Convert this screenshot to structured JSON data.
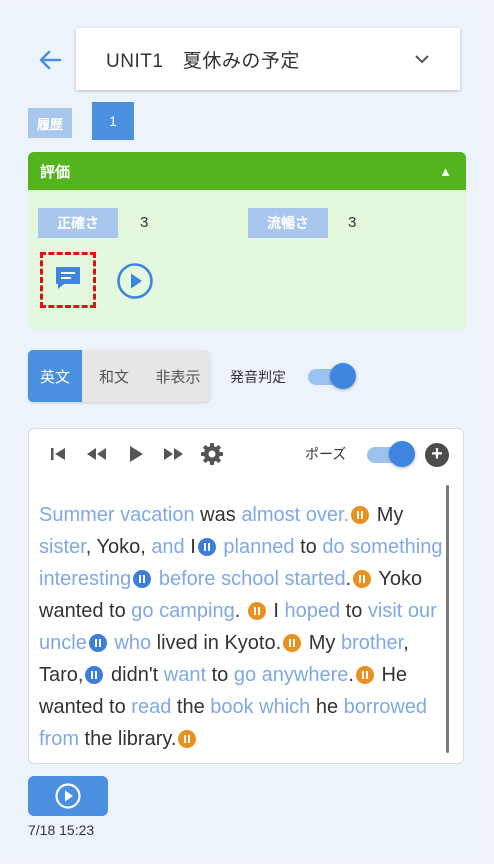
{
  "header": {
    "unit_title": "UNIT1　夏休みの予定"
  },
  "history": {
    "label": "履歴",
    "number": "1"
  },
  "evaluation": {
    "title": "評価",
    "accuracy_label": "正確さ",
    "accuracy_value": "3",
    "fluency_label": "流暢さ",
    "fluency_value": "3"
  },
  "display_tabs": [
    {
      "label": "英文",
      "active": true
    },
    {
      "label": "和文",
      "active": false
    },
    {
      "label": "非表示",
      "active": false
    }
  ],
  "pronunciation": {
    "label": "発音判定",
    "enabled": true
  },
  "player": {
    "pause_label": "ポーズ",
    "pause_enabled": true
  },
  "passage": [
    {
      "t": "Summer vacation",
      "hl": true
    },
    {
      "t": " was "
    },
    {
      "t": "almost over.",
      "hl": true
    },
    {
      "pm": "o"
    },
    {
      "t": " My "
    },
    {
      "t": "sister",
      "hl": true
    },
    {
      "t": ", Yoko, "
    },
    {
      "t": "and",
      "hl": true
    },
    {
      "t": " I"
    },
    {
      "pm": "b"
    },
    {
      "t": " "
    },
    {
      "t": "planned",
      "hl": true
    },
    {
      "t": " to "
    },
    {
      "t": "do something interesting",
      "hl": true
    },
    {
      "pm": "b"
    },
    {
      "t": " "
    },
    {
      "t": "before school started",
      "hl": true
    },
    {
      "t": "."
    },
    {
      "pm": "o"
    },
    {
      "t": " Yoko wanted to "
    },
    {
      "t": "go camping",
      "hl": true
    },
    {
      "t": ". "
    },
    {
      "pm": "o"
    },
    {
      "t": " I "
    },
    {
      "t": "hoped",
      "hl": true
    },
    {
      "t": " to "
    },
    {
      "t": "visit our uncle",
      "hl": true
    },
    {
      "pm": "b"
    },
    {
      "t": " "
    },
    {
      "t": "who",
      "hl": true
    },
    {
      "t": " lived in Kyoto."
    },
    {
      "pm": "o"
    },
    {
      "t": " My "
    },
    {
      "t": "brother",
      "hl": true
    },
    {
      "t": ", Taro,"
    },
    {
      "pm": "b"
    },
    {
      "t": " didn't "
    },
    {
      "t": "want",
      "hl": true
    },
    {
      "t": " to "
    },
    {
      "t": "go anywhere",
      "hl": true
    },
    {
      "t": "."
    },
    {
      "pm": "o"
    },
    {
      "t": " He wanted to "
    },
    {
      "t": "read",
      "hl": true
    },
    {
      "t": " the "
    },
    {
      "t": "book which",
      "hl": true
    },
    {
      "t": " he "
    },
    {
      "t": "borrowed from",
      "hl": true
    },
    {
      "t": " the library."
    },
    {
      "pm": "o"
    }
  ],
  "recording": {
    "timestamp": "7/18 15:23"
  }
}
